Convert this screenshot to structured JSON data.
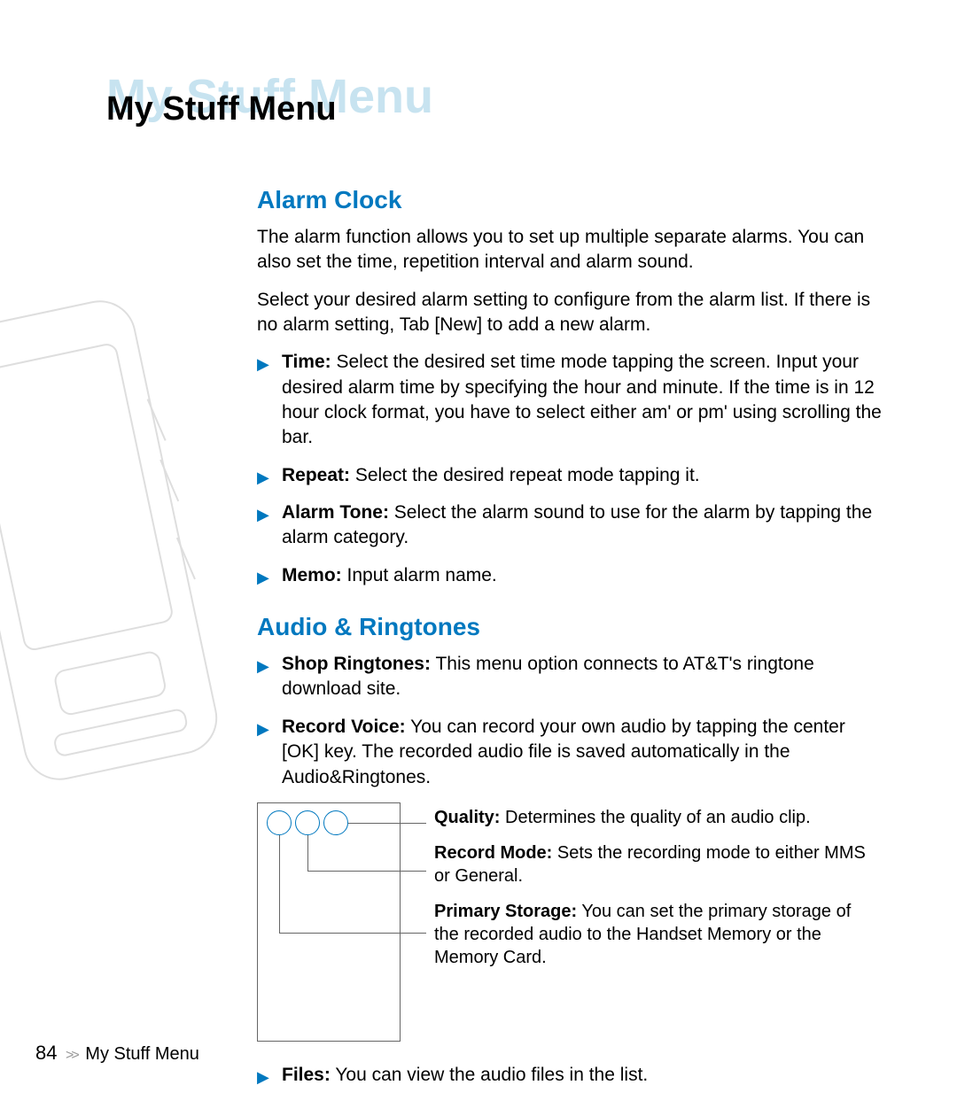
{
  "header": {
    "ghost_title": "My Stuff Menu",
    "main_title": "My Stuff Menu"
  },
  "section_alarm": {
    "heading": "Alarm Clock",
    "para1": "The alarm function allows you to set up multiple separate alarms. You can also set the time, repetition interval and alarm sound.",
    "para2": "Select your desired alarm setting to configure from the alarm list. If there is no alarm setting, Tab [New] to add a new alarm.",
    "bullets": [
      {
        "label": "Time:",
        "text": " Select the desired set time mode tapping the screen. Input your desired alarm time by specifying the hour and minute. If the time is in 12 hour clock format, you have to select either am' or pm' using scrolling the bar."
      },
      {
        "label": "Repeat:",
        "text": " Select the desired repeat mode tapping it."
      },
      {
        "label": "Alarm Tone:",
        "text": " Select the alarm sound to use for the alarm by tapping the alarm category."
      },
      {
        "label": "Memo:",
        "text": " Input alarm name."
      }
    ]
  },
  "section_audio": {
    "heading": "Audio & Ringtones",
    "bullets_top": [
      {
        "label": "Shop Ringtones:",
        "text": " This menu option connects to AT&T's ringtone download site."
      },
      {
        "label": "Record Voice:",
        "text": " You can record your own audio by tapping the center [OK] key. The recorded audio file is saved automatically in the Audio&Ringtones."
      }
    ],
    "diagram_labels": [
      {
        "label": "Quality:",
        "text": " Determines the quality of an audio clip."
      },
      {
        "label": "Record Mode:",
        "text": " Sets the recording mode to either MMS or General."
      },
      {
        "label": "Primary Storage:",
        "text": " You can set the primary storage of the recorded audio to the Handset Memory or the Memory Card."
      }
    ],
    "bullets_bottom": [
      {
        "label": "Files:",
        "text": " You can view the audio files in the list."
      }
    ]
  },
  "footer": {
    "page_number": "84",
    "chevrons": ">>",
    "section": "My Stuff Menu"
  }
}
